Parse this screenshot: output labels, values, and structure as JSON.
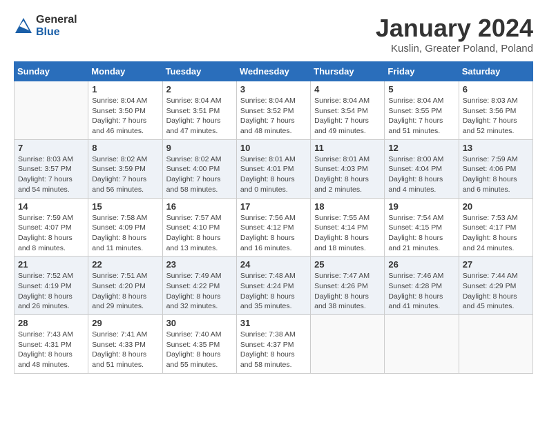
{
  "header": {
    "logo_general": "General",
    "logo_blue": "Blue",
    "month_title": "January 2024",
    "location": "Kuslin, Greater Poland, Poland"
  },
  "days_of_week": [
    "Sunday",
    "Monday",
    "Tuesday",
    "Wednesday",
    "Thursday",
    "Friday",
    "Saturday"
  ],
  "weeks": [
    [
      {
        "day": "",
        "info": ""
      },
      {
        "day": "1",
        "info": "Sunrise: 8:04 AM\nSunset: 3:50 PM\nDaylight: 7 hours\nand 46 minutes."
      },
      {
        "day": "2",
        "info": "Sunrise: 8:04 AM\nSunset: 3:51 PM\nDaylight: 7 hours\nand 47 minutes."
      },
      {
        "day": "3",
        "info": "Sunrise: 8:04 AM\nSunset: 3:52 PM\nDaylight: 7 hours\nand 48 minutes."
      },
      {
        "day": "4",
        "info": "Sunrise: 8:04 AM\nSunset: 3:54 PM\nDaylight: 7 hours\nand 49 minutes."
      },
      {
        "day": "5",
        "info": "Sunrise: 8:04 AM\nSunset: 3:55 PM\nDaylight: 7 hours\nand 51 minutes."
      },
      {
        "day": "6",
        "info": "Sunrise: 8:03 AM\nSunset: 3:56 PM\nDaylight: 7 hours\nand 52 minutes."
      }
    ],
    [
      {
        "day": "7",
        "info": "Sunrise: 8:03 AM\nSunset: 3:57 PM\nDaylight: 7 hours\nand 54 minutes."
      },
      {
        "day": "8",
        "info": "Sunrise: 8:02 AM\nSunset: 3:59 PM\nDaylight: 7 hours\nand 56 minutes."
      },
      {
        "day": "9",
        "info": "Sunrise: 8:02 AM\nSunset: 4:00 PM\nDaylight: 7 hours\nand 58 minutes."
      },
      {
        "day": "10",
        "info": "Sunrise: 8:01 AM\nSunset: 4:01 PM\nDaylight: 8 hours\nand 0 minutes."
      },
      {
        "day": "11",
        "info": "Sunrise: 8:01 AM\nSunset: 4:03 PM\nDaylight: 8 hours\nand 2 minutes."
      },
      {
        "day": "12",
        "info": "Sunrise: 8:00 AM\nSunset: 4:04 PM\nDaylight: 8 hours\nand 4 minutes."
      },
      {
        "day": "13",
        "info": "Sunrise: 7:59 AM\nSunset: 4:06 PM\nDaylight: 8 hours\nand 6 minutes."
      }
    ],
    [
      {
        "day": "14",
        "info": "Sunrise: 7:59 AM\nSunset: 4:07 PM\nDaylight: 8 hours\nand 8 minutes."
      },
      {
        "day": "15",
        "info": "Sunrise: 7:58 AM\nSunset: 4:09 PM\nDaylight: 8 hours\nand 11 minutes."
      },
      {
        "day": "16",
        "info": "Sunrise: 7:57 AM\nSunset: 4:10 PM\nDaylight: 8 hours\nand 13 minutes."
      },
      {
        "day": "17",
        "info": "Sunrise: 7:56 AM\nSunset: 4:12 PM\nDaylight: 8 hours\nand 16 minutes."
      },
      {
        "day": "18",
        "info": "Sunrise: 7:55 AM\nSunset: 4:14 PM\nDaylight: 8 hours\nand 18 minutes."
      },
      {
        "day": "19",
        "info": "Sunrise: 7:54 AM\nSunset: 4:15 PM\nDaylight: 8 hours\nand 21 minutes."
      },
      {
        "day": "20",
        "info": "Sunrise: 7:53 AM\nSunset: 4:17 PM\nDaylight: 8 hours\nand 24 minutes."
      }
    ],
    [
      {
        "day": "21",
        "info": "Sunrise: 7:52 AM\nSunset: 4:19 PM\nDaylight: 8 hours\nand 26 minutes."
      },
      {
        "day": "22",
        "info": "Sunrise: 7:51 AM\nSunset: 4:20 PM\nDaylight: 8 hours\nand 29 minutes."
      },
      {
        "day": "23",
        "info": "Sunrise: 7:49 AM\nSunset: 4:22 PM\nDaylight: 8 hours\nand 32 minutes."
      },
      {
        "day": "24",
        "info": "Sunrise: 7:48 AM\nSunset: 4:24 PM\nDaylight: 8 hours\nand 35 minutes."
      },
      {
        "day": "25",
        "info": "Sunrise: 7:47 AM\nSunset: 4:26 PM\nDaylight: 8 hours\nand 38 minutes."
      },
      {
        "day": "26",
        "info": "Sunrise: 7:46 AM\nSunset: 4:28 PM\nDaylight: 8 hours\nand 41 minutes."
      },
      {
        "day": "27",
        "info": "Sunrise: 7:44 AM\nSunset: 4:29 PM\nDaylight: 8 hours\nand 45 minutes."
      }
    ],
    [
      {
        "day": "28",
        "info": "Sunrise: 7:43 AM\nSunset: 4:31 PM\nDaylight: 8 hours\nand 48 minutes."
      },
      {
        "day": "29",
        "info": "Sunrise: 7:41 AM\nSunset: 4:33 PM\nDaylight: 8 hours\nand 51 minutes."
      },
      {
        "day": "30",
        "info": "Sunrise: 7:40 AM\nSunset: 4:35 PM\nDaylight: 8 hours\nand 55 minutes."
      },
      {
        "day": "31",
        "info": "Sunrise: 7:38 AM\nSunset: 4:37 PM\nDaylight: 8 hours\nand 58 minutes."
      },
      {
        "day": "",
        "info": ""
      },
      {
        "day": "",
        "info": ""
      },
      {
        "day": "",
        "info": ""
      }
    ]
  ]
}
